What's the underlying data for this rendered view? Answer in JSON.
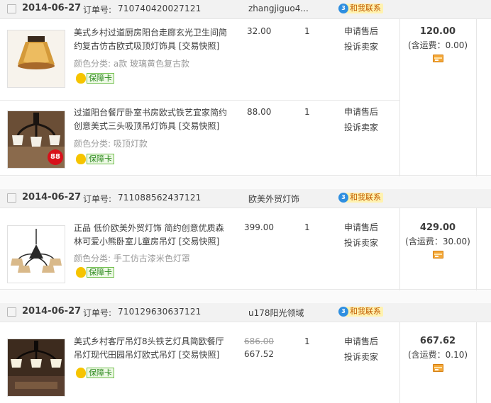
{
  "orders": [
    {
      "date": "2014-06-27",
      "order_no_label": "订单号:",
      "order_no": "710740420027121",
      "seller": "zhangjiguo4...",
      "contact_label": "和我联系",
      "total": "120.00",
      "shipping_note": "(含运费：0.00)",
      "items": [
        {
          "title": "美式乡村过道厨房阳台走廊玄光卫生间简约复古仿古欧式吸顶灯饰具 [交易快照]",
          "sku": "颜色分类: a款 玻璃黄色复古款",
          "guarantee": "保障卡",
          "price": "32.00",
          "qty": "1",
          "ops": [
            "申请售后",
            "投诉卖家"
          ]
        },
        {
          "title": "过道阳台餐厅卧室书房欧式铁艺宜家简约创意美式三头吸顶吊灯饰具 [交易快照]",
          "sku": "颜色分类: 吸顶灯款",
          "guarantee": "保障卡",
          "price": "88.00",
          "qty": "1",
          "badge": "88",
          "ops": [
            "申请售后",
            "投诉卖家"
          ]
        }
      ]
    },
    {
      "date": "2014-06-27",
      "order_no_label": "订单号:",
      "order_no": "711088562437121",
      "seller": "欧美外贸灯饰",
      "contact_label": "和我联系",
      "total": "429.00",
      "shipping_note": "(含运费：30.00)",
      "items": [
        {
          "title": "正品 低价欧美外贸灯饰 简约创意优质森林可爱小熊卧室儿童房吊灯 [交易快照]",
          "sku": "颜色分类: 手工仿古漆米色灯罩",
          "guarantee": "保障卡",
          "price": "399.00",
          "qty": "1",
          "ops": [
            "申请售后",
            "投诉卖家"
          ]
        }
      ]
    },
    {
      "date": "2014-06-27",
      "order_no_label": "订单号:",
      "order_no": "710129630637121",
      "seller": "u178阳光领域",
      "contact_label": "和我联系",
      "total": "667.62",
      "shipping_note": "(含运费：0.10)",
      "items": [
        {
          "title": "美式乡村客厅吊灯8头铁艺灯具简欧餐厅吊灯现代田园吊灯欧式吊灯 [交易快照]",
          "guarantee": "保障卡",
          "price_original": "686.00",
          "price": "667.52",
          "qty": "1",
          "ops": [
            "申请售后",
            "投诉卖家"
          ]
        }
      ]
    }
  ],
  "icons": {
    "contact": "wangwang-chat-icon",
    "guarantee": "shield-guarantee-icon",
    "payment": "payment-card-icon"
  },
  "colors": {
    "header_bg": "#f2f2f2",
    "contact_bg": "#fff2b0",
    "contact_text": "#c15a00",
    "guarantee_green": "#2d8a1f",
    "card_orange": "#f4a83a"
  }
}
